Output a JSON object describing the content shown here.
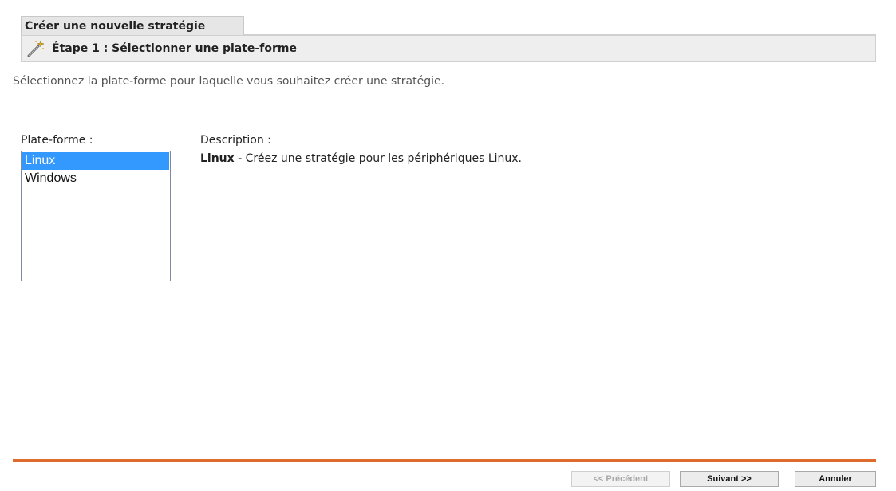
{
  "header": {
    "title": "Créer une nouvelle stratégie",
    "step_title": "Étape 1 : Sélectionner une plate-forme",
    "step_icon": "magic-wand-icon"
  },
  "instruction": "Sélectionnez la plate-forme pour laquelle vous souhaitez créer une stratégie.",
  "platform": {
    "label": "Plate-forme :",
    "options": [
      {
        "label": "Linux",
        "selected": true
      },
      {
        "label": "Windows",
        "selected": false
      }
    ]
  },
  "description": {
    "label": "Description :",
    "name": "Linux",
    "text": " - Créez une stratégie pour les périphériques Linux."
  },
  "colors": {
    "accent_line": "#de6a2d",
    "selection": "#3399ff"
  },
  "buttons": {
    "previous": "<< Précédent",
    "next": "Suivant >>",
    "cancel": "Annuler"
  }
}
